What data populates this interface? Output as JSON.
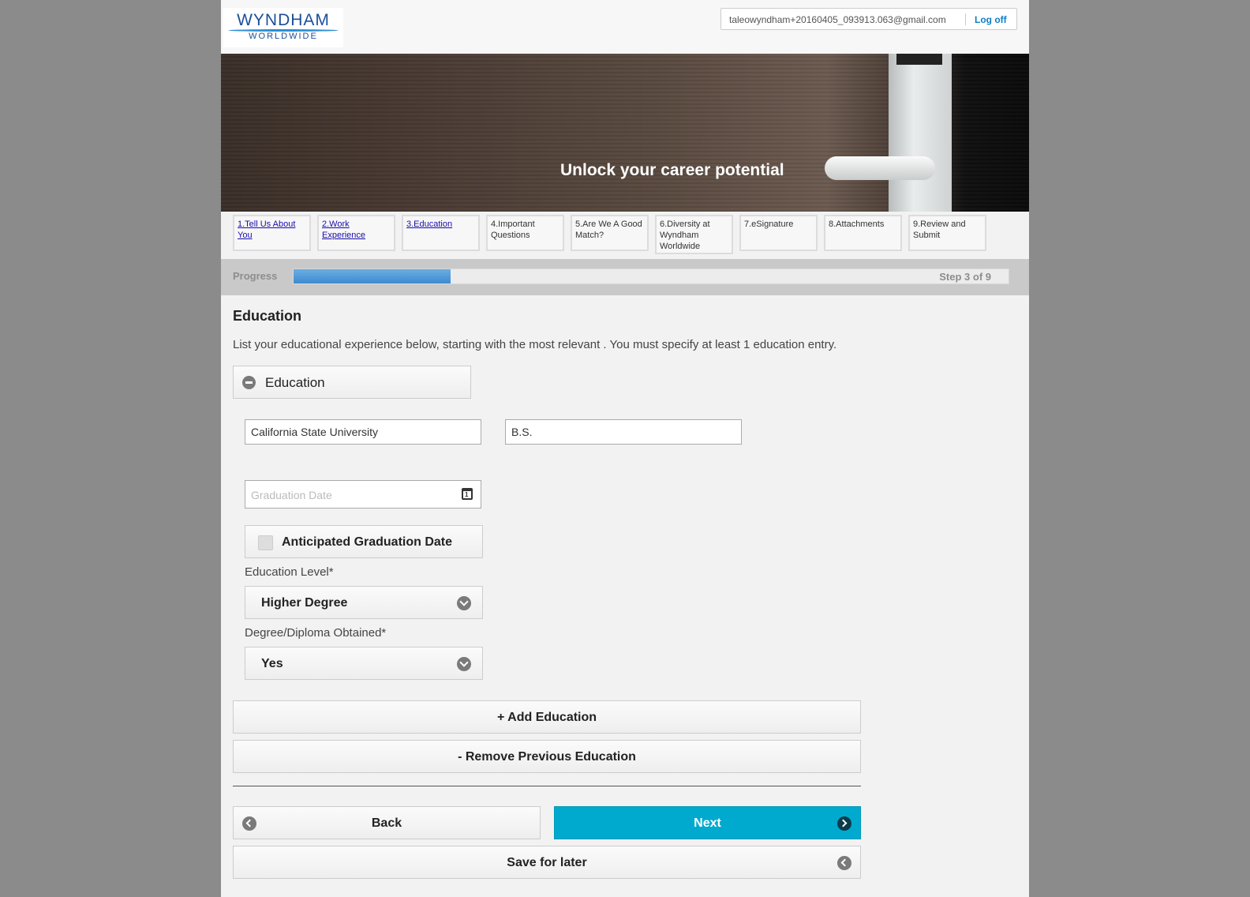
{
  "header": {
    "logo_line1": "WYNDHAM",
    "logo_line2": "WORLDWIDE",
    "user_email": "taleowyndham+20160405_093913.063@gmail.com",
    "logoff_label": "Log off"
  },
  "banner": {
    "tagline": "Unlock your career potential"
  },
  "steps": [
    {
      "label": "1.Tell Us About You",
      "link": true
    },
    {
      "label": "2.Work Experience",
      "link": true
    },
    {
      "label": "3.Education",
      "link": true
    },
    {
      "label": "4.Important Questions",
      "link": false
    },
    {
      "label": "5.Are We A Good Match?",
      "link": false
    },
    {
      "label": "6.Diversity at Wyndham Worldwide",
      "link": false
    },
    {
      "label": "7.eSignature",
      "link": false
    },
    {
      "label": "8.Attachments",
      "link": false
    },
    {
      "label": "9.Review and Submit",
      "link": false
    }
  ],
  "progress": {
    "label": "Progress",
    "step_text": "Step 3 of 9",
    "fraction": 0.22
  },
  "page": {
    "title": "Education",
    "instructions": "List your educational experience below, starting with the most relevant . You must specify at least 1 education entry."
  },
  "education_entry": {
    "section_label": "Education",
    "school_value": "California State University",
    "degree_value": "B.S.",
    "graduation_date_placeholder": "Graduation Date",
    "anticipated_label": "Anticipated Graduation Date",
    "level_label": "Education Level*",
    "level_value": "Higher Degree",
    "diploma_label": "Degree/Diploma Obtained*",
    "diploma_value": "Yes"
  },
  "actions": {
    "add_label": "+ Add Education",
    "remove_label": "- Remove Previous Education",
    "back_label": "Back",
    "next_label": "Next",
    "save_label": "Save for later"
  },
  "colors": {
    "accent": "#00aacf",
    "progress": "#4a95d8",
    "link": "#0d7fc4"
  }
}
